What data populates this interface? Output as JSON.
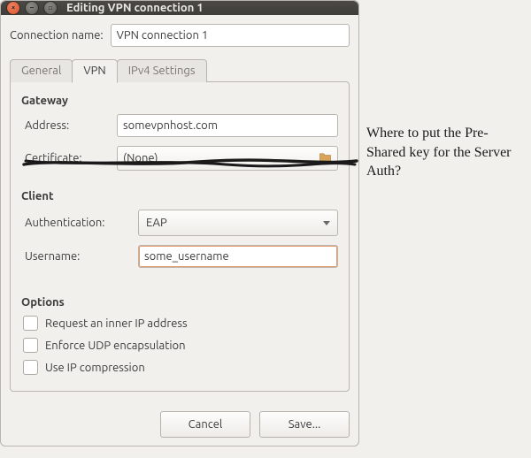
{
  "window": {
    "title": "Editing VPN connection 1",
    "close_icon": "close-icon",
    "min_icon": "minimize-icon",
    "max_icon": "maximize-icon"
  },
  "connection_name": {
    "label": "Connection name:",
    "value": "VPN connection 1"
  },
  "tabs": {
    "general": "General",
    "vpn": "VPN",
    "ipv4": "IPv4 Settings"
  },
  "gateway": {
    "section": "Gateway",
    "address_label": "Address:",
    "address_value": "somevpnhost.com",
    "cert_label": "Certificate:",
    "cert_value": "(None)"
  },
  "client": {
    "section": "Client",
    "auth_label": "Authentication:",
    "auth_value": "EAP",
    "username_label": "Username:",
    "username_value": "some_username"
  },
  "options": {
    "section": "Options",
    "request_inner_ip": "Request an inner IP address",
    "enforce_udp": "Enforce UDP encapsulation",
    "ip_compression": "Use IP compression"
  },
  "buttons": {
    "cancel": "Cancel",
    "save": "Save..."
  },
  "annotation": {
    "text": "Where to put the Pre-Shared key for the Server Auth?"
  }
}
